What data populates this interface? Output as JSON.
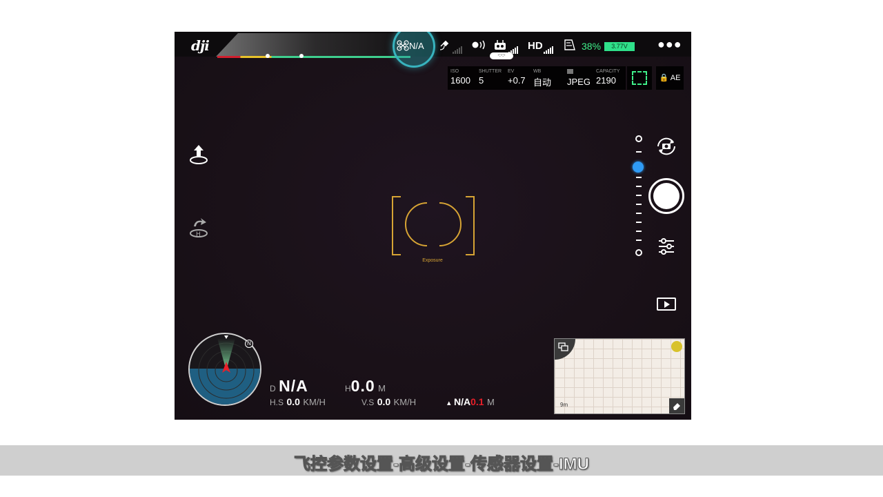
{
  "app": {
    "logo": "dji"
  },
  "status_bar": {
    "flight_mode": "N/A",
    "hd_label": "HD",
    "battery_percent": "38%",
    "battery_voltage": "3.77V",
    "more_icon": "more-dots-icon",
    "rc_status": "-:-:-"
  },
  "camera": {
    "iso_label": "ISO",
    "iso": "1600",
    "shutter_label": "SHUTTER",
    "shutter": "5",
    "ev_label": "EV",
    "ev": "+0.7",
    "wb_label": "WB",
    "wb": "自动",
    "format": "JPEG",
    "capacity_label": "CAPACITY",
    "capacity": "2190",
    "ae_label": "AE"
  },
  "viewfinder": {
    "exposure_label": "Exposure"
  },
  "radar": {
    "north_label": "N"
  },
  "telemetry": {
    "d_label": "D",
    "distance": "N/A",
    "h_label": "H",
    "height": "0.0",
    "h_unit": "M",
    "hs_label": "H.S",
    "hs_value": "0.0",
    "hs_unit": "KM/H",
    "vs_label": "V.S",
    "vs_value": "0.0",
    "vs_unit": "KM/H",
    "vps_value": "N/A",
    "vps_overlay": "0.1",
    "vps_unit": "M"
  },
  "map": {
    "scale": "9m"
  },
  "colors": {
    "accent_green": "#3ff08a",
    "mode_ring": "#38b3be",
    "focus_gold": "#d7a434",
    "slider_blue": "#2f9bf5"
  },
  "subtitle": "飞控参数设置-高级设置-传感器设置-IMU"
}
